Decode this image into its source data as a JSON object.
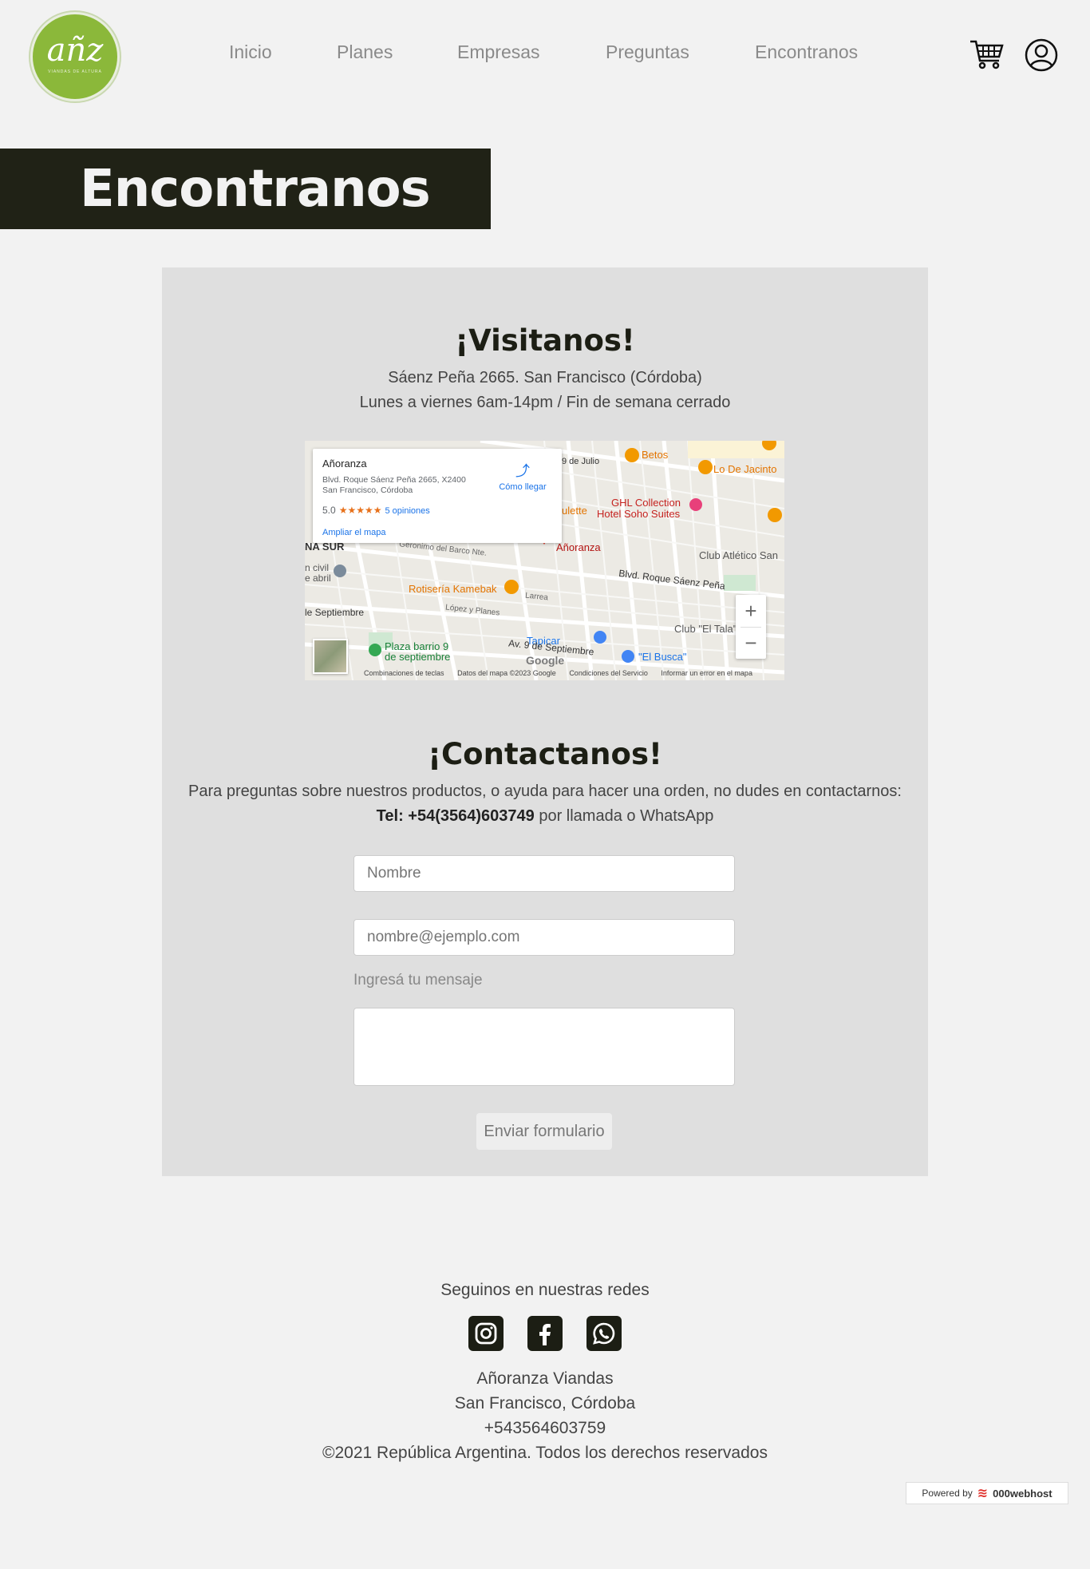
{
  "brand": {
    "logo_text": "añz",
    "logo_sub": "VIANDAS DE ALTURA"
  },
  "nav": {
    "items": [
      "Inicio",
      "Planes",
      "Empresas",
      "Preguntas",
      "Encontranos"
    ]
  },
  "header_icons": [
    "cart-icon",
    "user-icon"
  ],
  "page_title": "Encontranos",
  "visit": {
    "title": "¡Visitanos!",
    "address": "Sáenz Peña 2665. San Francisco (Córdoba)",
    "hours": "Lunes a viernes 6am-14pm / Fin de semana cerrado"
  },
  "map": {
    "place_name": "Añoranza",
    "place_address_1": "Blvd. Roque Sáenz Peña 2665, X2400",
    "place_address_2": "San Francisco, Córdoba",
    "rating": "5.0",
    "stars": "★★★★★",
    "reviews": "5 opiniones",
    "directions": "Cómo llegar",
    "enlarge": "Ampliar el mapa",
    "zoom_in": "+",
    "zoom_out": "−",
    "google": "Google",
    "footer_shortcuts": "Combinaciones de teclas",
    "footer_data": "Datos del mapa ©2023 Google",
    "footer_terms": "Condiciones del Servicio",
    "footer_report": "Informar un error en el mapa",
    "labels": {
      "betos": "Betos",
      "lo_de_jacinto": "Lo De Jacinto",
      "ghl": "GHL Collection",
      "soho": "Hotel Soho Suites",
      "ulette": "ulette",
      "anoranza": "Añoranza",
      "club_atletico": "Club Atlético San",
      "rotiseria": "Rotisería Kamebak",
      "blvd": "Blvd. Roque Sáenz Peña",
      "club_tala": "Club \"El Tala\"",
      "tapicar": "Tapicar",
      "plaza_1": "Plaza barrio 9",
      "plaza_2": "de septiembre",
      "av_9": "Av. 9 de Septiembre",
      "el_busca": "\"El Busca\"",
      "sur": "NA SUR",
      "civil_1": "n civil",
      "civil_2": "e abril",
      "septiembre": "le Septiembre",
      "geronimo": "Geronimo del Barco Nte.",
      "lopez": "López y Planes",
      "larrea": "Larrea",
      "julio": "9 de Julio"
    }
  },
  "contact": {
    "title": "¡Contactanos!",
    "text": "Para preguntas sobre nuestros productos, o ayuda para hacer una orden, no dudes en contactarnos:",
    "tel_label": "Tel: +54(3564)603749",
    "tel_suffix": "por llamada o WhatsApp",
    "name_placeholder": "Nombre",
    "email_placeholder": "nombre@ejemplo.com",
    "message_label": "Ingresá tu mensaje",
    "submit": "Enviar formulario"
  },
  "footer": {
    "follow": "Seguinos en nuestras redes",
    "social": [
      "instagram-icon",
      "facebook-icon",
      "whatsapp-icon"
    ],
    "company": "Añoranza Viandas",
    "city": "San Francisco, Córdoba",
    "phone": "+543564603759",
    "copyright": "©2021 República Argentina. Todos los derechos reservados"
  },
  "badge": {
    "prefix": "Powered by",
    "brand": "000webhost"
  },
  "colors": {
    "dark_band": "#202216",
    "logo_green": "#8bb83a",
    "card_bg": "#dfdfdf"
  }
}
